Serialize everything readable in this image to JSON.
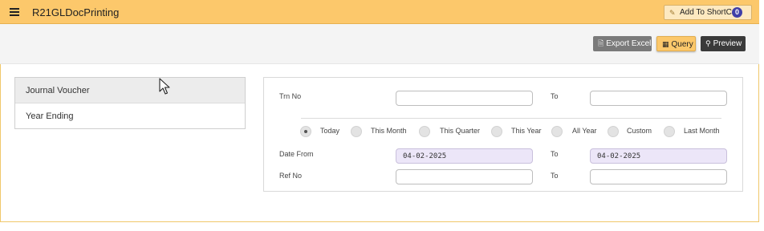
{
  "header": {
    "title": "R21GLDocPrinting",
    "shortcut_label": "Add To ShortCut",
    "shortcut_count": "0"
  },
  "toolbar": {
    "export_excel": "Export Excel",
    "query": "Query",
    "preview": "Preview"
  },
  "doc_types": {
    "items": [
      "Journal Voucher",
      "Year Ending"
    ],
    "selected": "Journal Voucher"
  },
  "form": {
    "trn_no_label": "Trn No",
    "to_label": "To",
    "trn_no_from": "",
    "trn_no_to": "",
    "period_options": [
      "Today",
      "This Month",
      "This Quarter",
      "This Year",
      "All Year",
      "Custom",
      "Last Month"
    ],
    "period_selected": "Today",
    "date_from_label": "Date From",
    "date_from": "04-02-2025",
    "date_to": "04-02-2025",
    "ref_no_label": "Ref No",
    "ref_no_from": "",
    "ref_no_to": ""
  },
  "colors": {
    "header_bg": "#fcc86b",
    "date_input_bg": "#ece6f8",
    "badge": "#3f3fa8"
  }
}
